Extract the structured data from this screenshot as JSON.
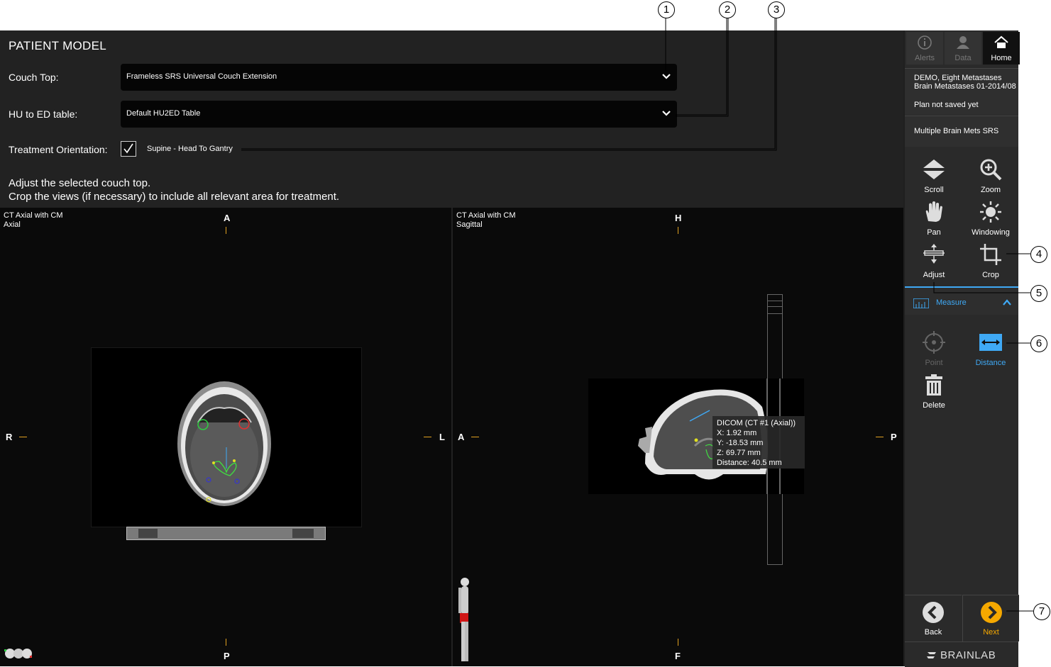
{
  "header": {
    "title": "PATIENT MODEL"
  },
  "couch_top": {
    "label": "Couch Top:",
    "value": "Frameless SRS Universal Couch Extension"
  },
  "hu_table": {
    "label": "HU to ED table:",
    "value": "Default HU2ED Table"
  },
  "orientation": {
    "label": "Treatment Orientation:",
    "value": "Supine - Head To Gantry",
    "checked": true
  },
  "instructions": [
    "Adjust the selected couch top.",
    "Crop the views (if necessary) to include all relevant area for treatment."
  ],
  "views": {
    "axial": {
      "title": "CT Axial with CM",
      "subtitle": "Axial",
      "top": "A",
      "bottom": "P",
      "left": "R",
      "right": "L"
    },
    "sagittal": {
      "title": "CT Axial with CM",
      "subtitle": "Sagittal",
      "top": "H",
      "bottom": "F",
      "left": "A",
      "right": "P"
    }
  },
  "measurement": {
    "source": "DICOM (CT #1 (Axial))",
    "x": "X: 1.92 mm",
    "y": "Y: -18.53 mm",
    "z": "Z: 69.77 mm",
    "distance": "Distance: 40.5 mm"
  },
  "sidebar": {
    "top_tabs": [
      {
        "label": "Alerts",
        "icon": "info-icon"
      },
      {
        "label": "Data",
        "icon": "patient-data-icon"
      },
      {
        "label": "Home",
        "icon": "home-icon"
      }
    ],
    "patient": {
      "name": "DEMO, Eight Metastases",
      "case": "Brain Metastases 01-2014/08",
      "status": "Plan not saved yet"
    },
    "plan_name": "Multiple Brain Mets SRS",
    "tools": [
      {
        "label": "Scroll",
        "icon": "scroll-icon"
      },
      {
        "label": "Zoom",
        "icon": "zoom-icon"
      },
      {
        "label": "Pan",
        "icon": "hand-icon"
      },
      {
        "label": "Windowing",
        "icon": "windowing-icon"
      },
      {
        "label": "Adjust",
        "icon": "adjust-icon"
      },
      {
        "label": "Crop",
        "icon": "crop-icon"
      }
    ],
    "measure": {
      "label": "Measure",
      "expanded": true
    },
    "measure_tools": [
      {
        "label": "Point",
        "icon": "point-icon",
        "enabled": false
      },
      {
        "label": "Distance",
        "icon": "distance-icon",
        "active": true
      },
      {
        "label": "Delete",
        "icon": "delete-icon"
      }
    ],
    "nav": {
      "back": "Back",
      "next": "Next"
    },
    "brand": "BRAINLAB"
  },
  "callouts": [
    "1",
    "2",
    "3",
    "4",
    "5",
    "6",
    "7"
  ],
  "colors": {
    "accent": "#f5a800",
    "measure_blue": "#3fa9f5",
    "panel": "#222222",
    "view_bg": "#0a0a0a"
  }
}
